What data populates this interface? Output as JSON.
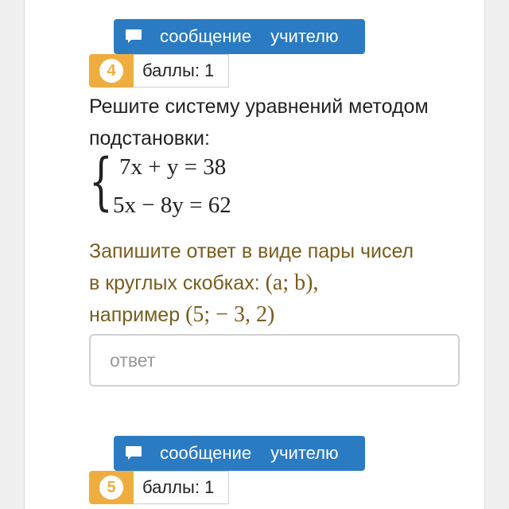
{
  "task4": {
    "message_word1": "сообщение",
    "message_word2": "учителю",
    "number": "4",
    "points": "баллы: 1",
    "question": "Решите систему уравнений методом подстановки:",
    "equation1": "7x + y = 38",
    "equation2": "5x − 8y = 62",
    "hint_line1": "Запишите ответ в виде пары чисел",
    "hint_line2_text": "в круглых скобках: ",
    "hint_line2_math": "(a; b),",
    "hint_line3_text": "например ",
    "hint_line3_math": "(5;  − 3, 2)",
    "answer_placeholder": "ответ"
  },
  "task5": {
    "message_word1": "сообщение",
    "message_word2": "учителю",
    "number": "5",
    "points": "баллы: 1"
  },
  "colors": {
    "message_button": "#2b7bc2",
    "number_badge": "#f0ad3f",
    "hint_text": "#7a5c1d"
  },
  "icons": {
    "message_button": "speech-bubble-icon"
  }
}
